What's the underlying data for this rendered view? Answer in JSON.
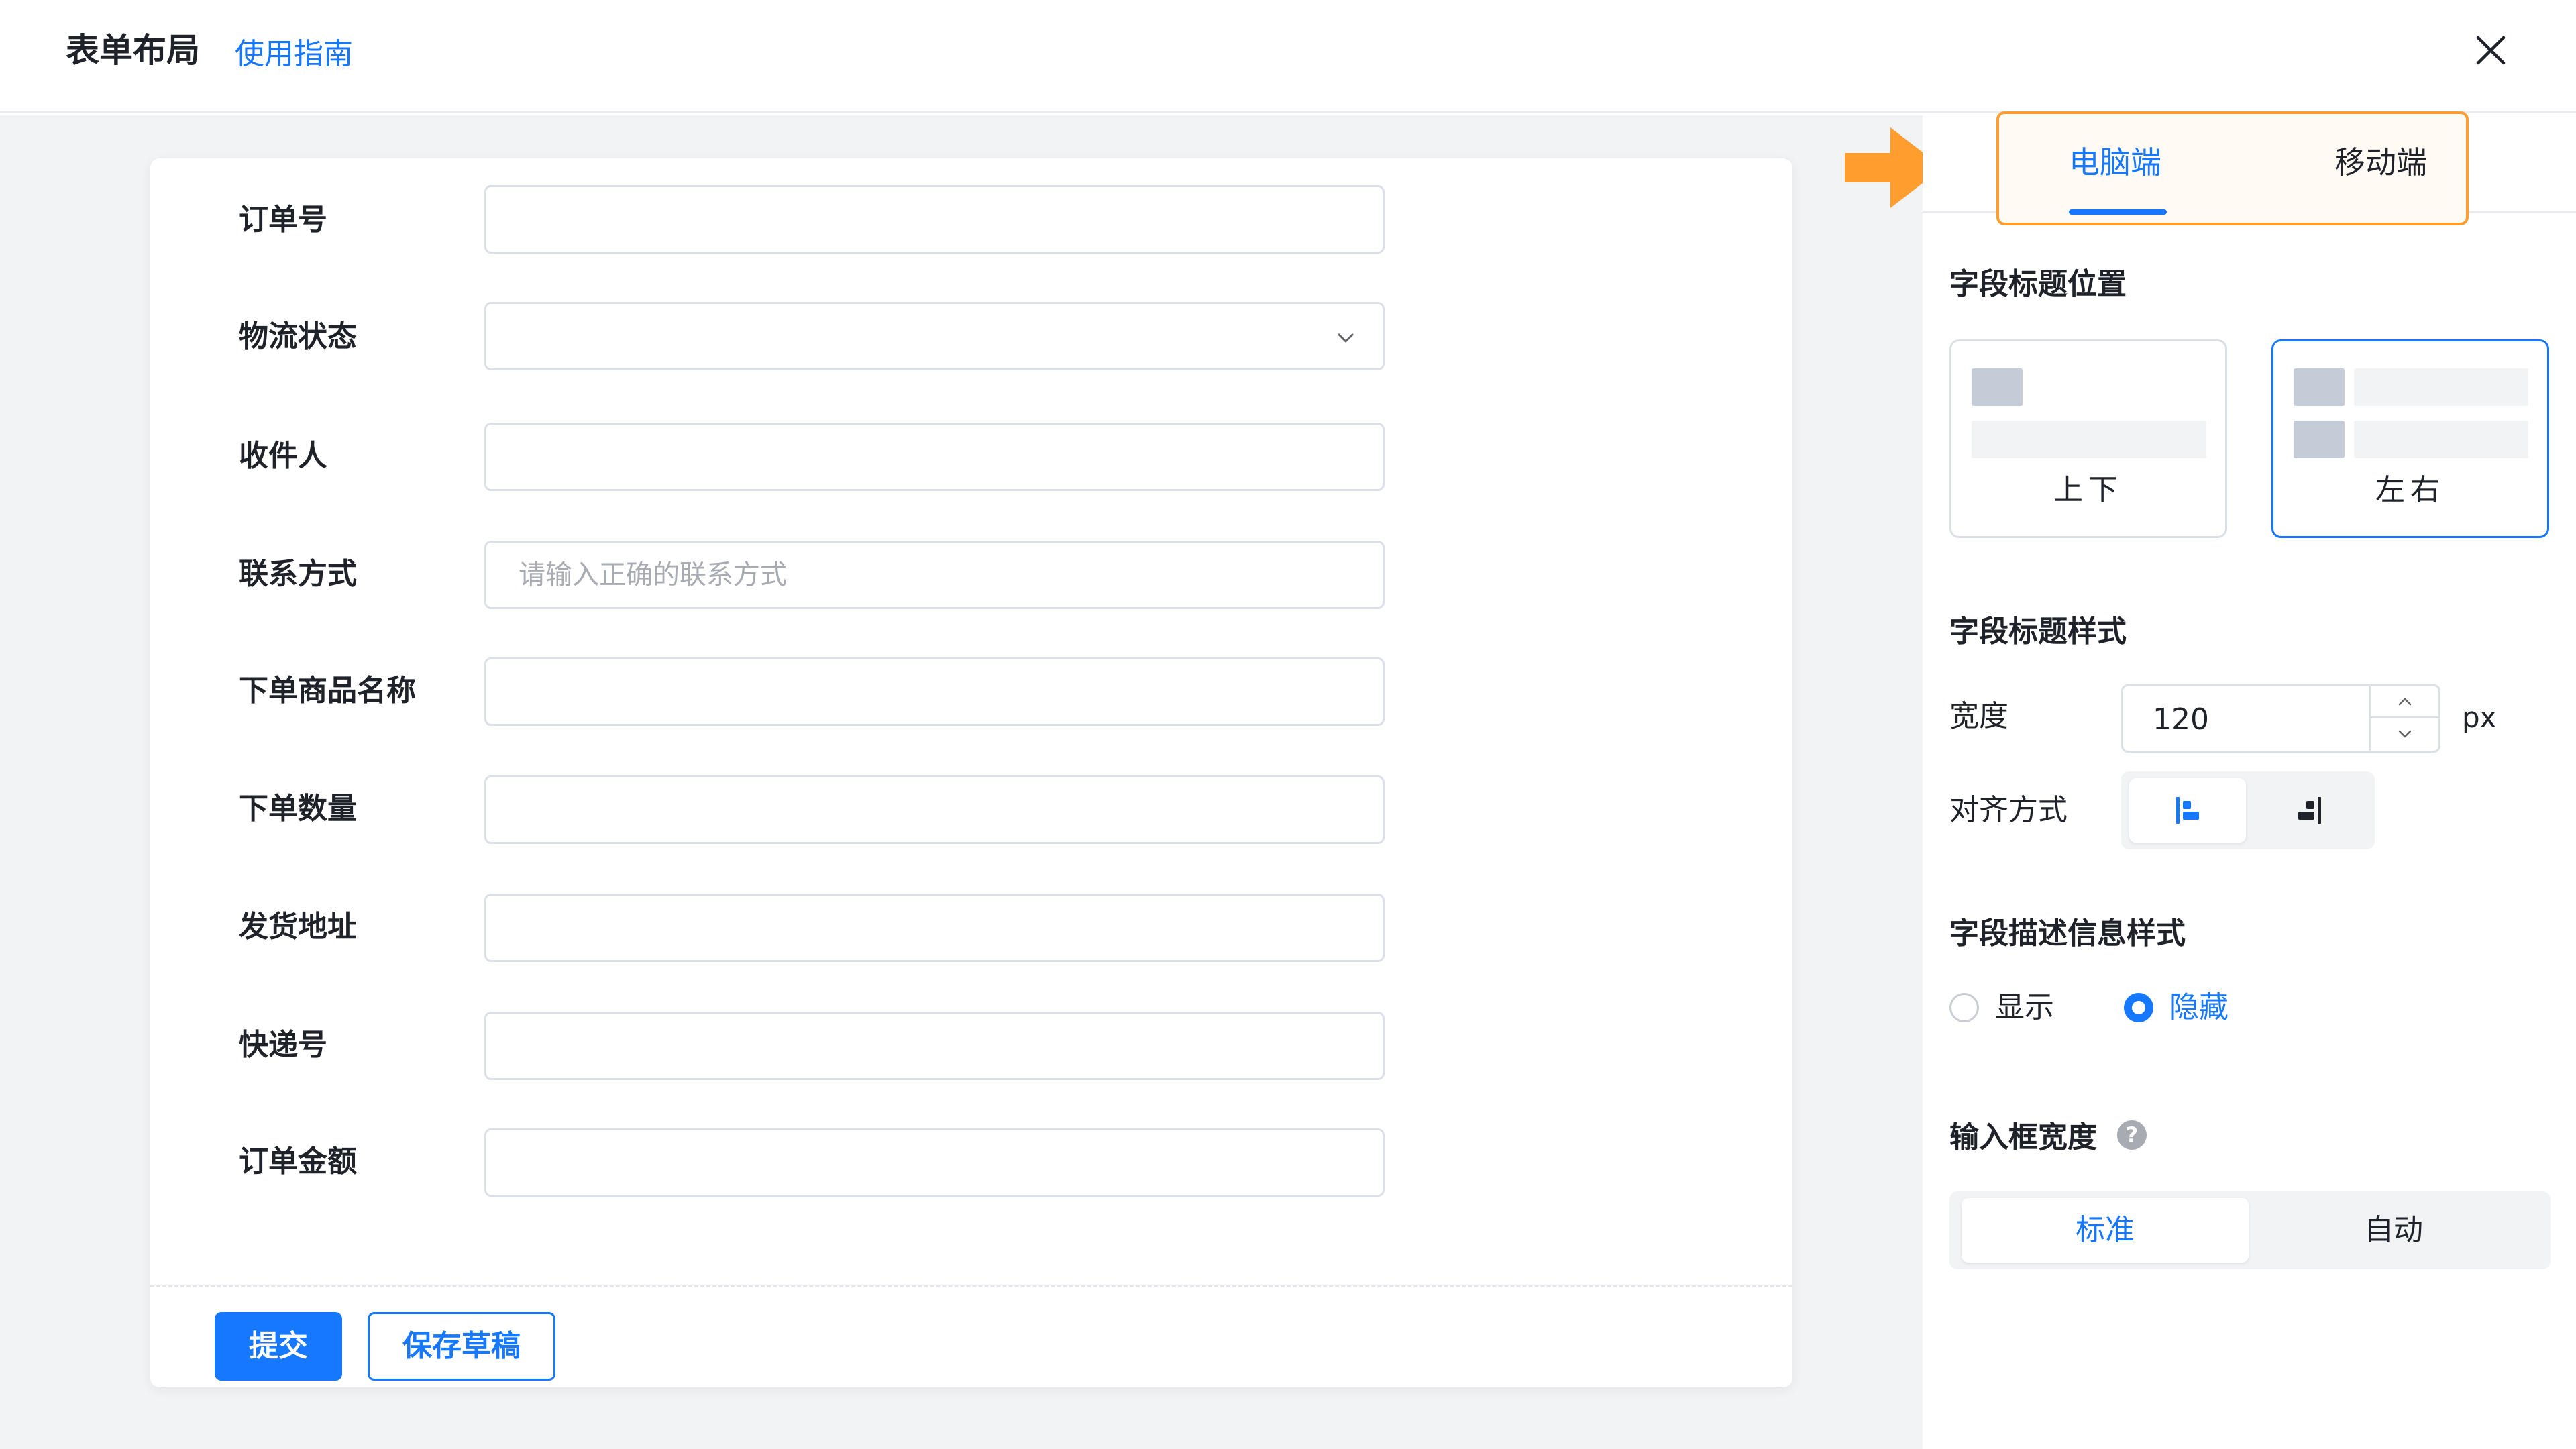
{
  "header": {
    "title": "表单布局",
    "guide_link": "使用指南"
  },
  "form": {
    "fields": [
      {
        "label": "订单号",
        "value": "",
        "placeholder": ""
      },
      {
        "label": "物流状态",
        "value": "",
        "placeholder": ""
      },
      {
        "label": "收件人",
        "value": "",
        "placeholder": ""
      },
      {
        "label": "联系方式",
        "value": "",
        "placeholder": "请输入正确的联系方式"
      },
      {
        "label": "下单商品名称",
        "value": "",
        "placeholder": ""
      },
      {
        "label": "下单数量",
        "value": "",
        "placeholder": ""
      },
      {
        "label": "发货地址",
        "value": "",
        "placeholder": ""
      },
      {
        "label": "快递号",
        "value": "",
        "placeholder": ""
      },
      {
        "label": "订单金额",
        "value": "",
        "placeholder": ""
      }
    ],
    "submit_label": "提交",
    "draft_label": "保存草稿"
  },
  "panel": {
    "device_tabs": [
      {
        "label": "电脑端",
        "active": true
      },
      {
        "label": "移动端",
        "active": false
      }
    ],
    "label_position": {
      "title": "字段标题位置",
      "options": [
        {
          "label": "上下",
          "selected": false
        },
        {
          "label": "左右",
          "selected": true
        }
      ]
    },
    "label_style": {
      "title": "字段标题样式",
      "width_label": "宽度",
      "width_value": "120",
      "width_unit": "px",
      "align_label": "对齐方式",
      "align_selected": "left"
    },
    "description_style": {
      "title": "字段描述信息样式",
      "options": [
        {
          "label": "显示",
          "checked": false
        },
        {
          "label": "隐藏",
          "checked": true
        }
      ]
    },
    "input_width": {
      "title": "输入框宽度",
      "help_symbol": "?",
      "options": [
        {
          "label": "标准",
          "active": true
        },
        {
          "label": "自动",
          "active": false
        }
      ]
    }
  },
  "colors": {
    "accent": "#1677ff",
    "highlight": "#ff9d2e",
    "canvas_bg": "#f2f3f5"
  },
  "icons": {
    "close": "close-icon",
    "dropdown": "chevron-down-icon",
    "arrow": "arrow-right-icon",
    "stepper_up": "chevron-up-icon",
    "stepper_down": "chevron-down-icon",
    "align_left": "align-left-icon",
    "align_right": "align-right-icon",
    "help": "question-circle-icon"
  }
}
